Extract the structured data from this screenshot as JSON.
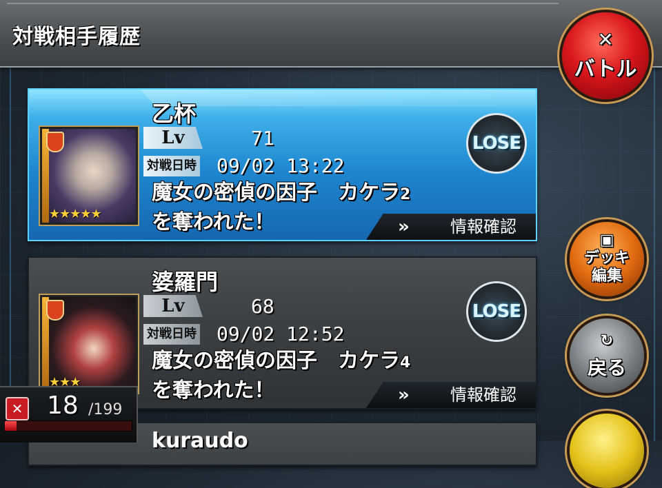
{
  "header": {
    "title": "対戦相手履歴"
  },
  "buttons": {
    "battle": {
      "label": "バトル",
      "icon": "crossed-swords-icon"
    },
    "deck": {
      "label_line1": "デッキ",
      "label_line2": "編集",
      "icon": "deck-icon"
    },
    "back": {
      "label": "戻る",
      "icon": "refresh-arrow-icon"
    }
  },
  "labels": {
    "lv": "Lv",
    "battle_date": "対戦日時",
    "info": "情報確認",
    "result": "LOSE"
  },
  "history": [
    {
      "name": "乙杯",
      "level": "71",
      "date": "09/02 13:22",
      "message_line1": "魔女の密偵の因子　カケラ",
      "message_count": "2",
      "message_line2": "を奪われた！",
      "stars": "★★★★★",
      "result": "LOSE"
    },
    {
      "name": "婆羅門",
      "level": "68",
      "date": "09/02 12:52",
      "message_line1": "魔女の密偵の因子　カケラ",
      "message_count": "4",
      "message_line2": "を奪われた！",
      "stars": "★★★",
      "result": "LOSE"
    },
    {
      "name": "kuraudo"
    }
  ],
  "stamina": {
    "current": "18",
    "max": "/199",
    "fraction": 0.09
  },
  "colors": {
    "active_card": "#1e86cf",
    "battle_button": "#d8161c",
    "deck_button": "#e16a10",
    "stamina": "#c81c22"
  }
}
